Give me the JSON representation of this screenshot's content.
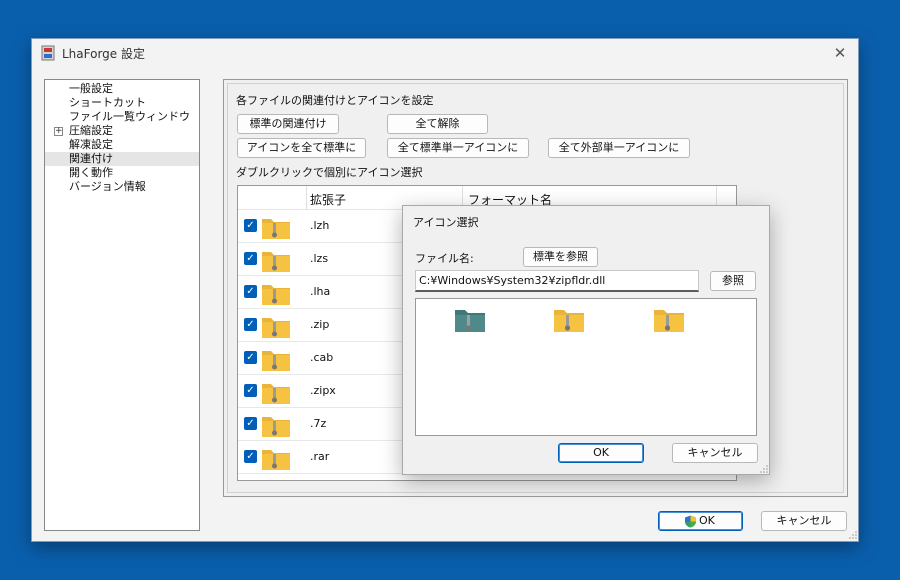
{
  "window": {
    "title": "LhaForge 設定",
    "close_glyph": "✕",
    "ok_label": "OK",
    "cancel_label": "キャンセル"
  },
  "tree": {
    "items": [
      "一般設定",
      "ショートカット",
      "ファイル一覧ウィンドウ",
      "圧縮設定",
      "解凍設定",
      "関連付け",
      "開く動作",
      "バージョン情報"
    ],
    "selected": "関連付け",
    "expander_glyph": "+"
  },
  "assoc": {
    "heading": "各ファイルの関連付けとアイコンを設定",
    "btn_default_assoc": "標準の関連付け",
    "btn_unassoc_all": "全て解除",
    "btn_icons_default": "アイコンを全て標準に",
    "btn_single_default": "全て標準単一アイコンに",
    "btn_single_external": "全て外部単一アイコンに",
    "list_caption": "ダブルクリックで個別にアイコン選択",
    "col_ext": "拡張子",
    "col_format": "フォーマット名",
    "rows": [
      ".lzh",
      ".lzs",
      ".lha",
      ".zip",
      ".cab",
      ".zipx",
      ".7z",
      ".rar"
    ],
    "check_glyph": "✓"
  },
  "icon_dialog": {
    "title": "アイコン選択",
    "filename_label": "ファイル名:",
    "browse_default": "標準を参照",
    "path": "C:¥Windows¥System32¥zipfldr.dll",
    "browse": "参照",
    "ok": "OK",
    "cancel": "キャンセル"
  },
  "colors": {
    "desktop": "#0a5fad",
    "accent": "#005fb8",
    "folder_yellow": "#f5c242",
    "folder_teal": "#4f8a8b"
  }
}
